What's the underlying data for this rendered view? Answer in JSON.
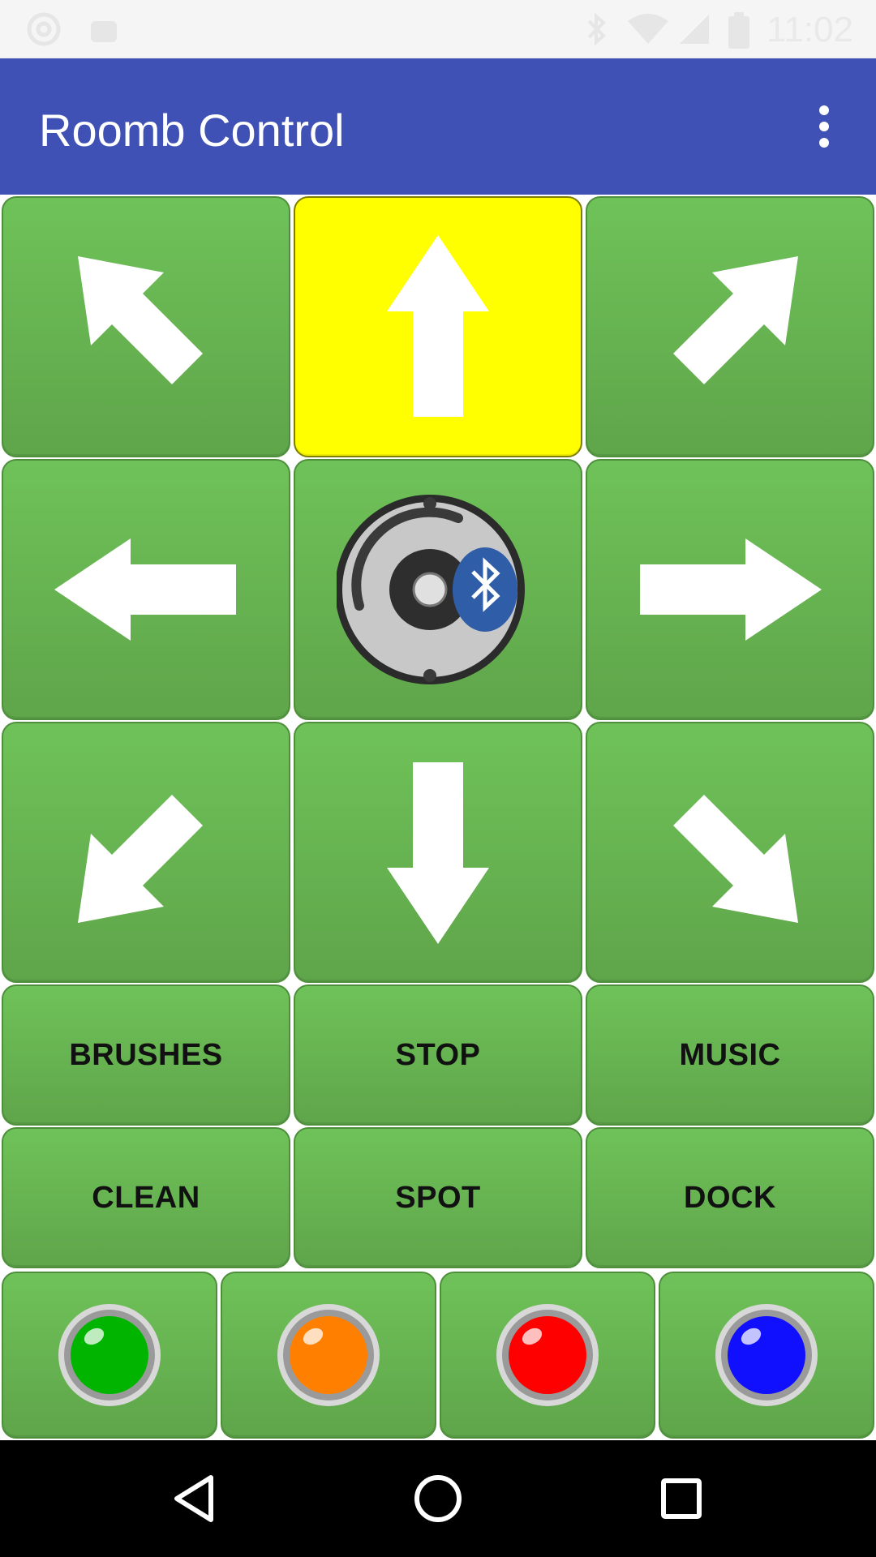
{
  "status_bar": {
    "time": "11:02",
    "icons": [
      "at-sign-icon",
      "android-icon",
      "bluetooth-icon",
      "wifi-icon",
      "cell-signal-icon",
      "battery-icon"
    ]
  },
  "app_bar": {
    "title": "Roomb Control",
    "menu_icon": "overflow-menu-icon"
  },
  "direction_pad": {
    "buttons": [
      {
        "name": "forward-left",
        "icon": "arrow-up-left-icon",
        "active": false
      },
      {
        "name": "forward",
        "icon": "arrow-up-icon",
        "active": true
      },
      {
        "name": "forward-right",
        "icon": "arrow-up-right-icon",
        "active": false
      },
      {
        "name": "left",
        "icon": "arrow-left-icon",
        "active": false
      },
      {
        "name": "connect",
        "icon": "roomba-bluetooth-icon",
        "active": false
      },
      {
        "name": "right",
        "icon": "arrow-right-icon",
        "active": false
      },
      {
        "name": "back-left",
        "icon": "arrow-down-left-icon",
        "active": false
      },
      {
        "name": "back",
        "icon": "arrow-down-icon",
        "active": false
      },
      {
        "name": "back-right",
        "icon": "arrow-down-right-icon",
        "active": false
      }
    ]
  },
  "commands": {
    "brushes": "BRUSHES",
    "stop": "STOP",
    "music": "MUSIC",
    "clean": "CLEAN",
    "spot": "SPOT",
    "dock": "DOCK"
  },
  "leds": {
    "colors": [
      "#00b400",
      "#ff8000",
      "#ff0000",
      "#1010ff"
    ]
  },
  "colors": {
    "app_bar": "#3f51b5",
    "tile_green": "#6fc259",
    "active_yellow": "#ffff00"
  },
  "nav_bar": {
    "icons": [
      "back-icon",
      "home-icon",
      "recents-icon"
    ]
  }
}
